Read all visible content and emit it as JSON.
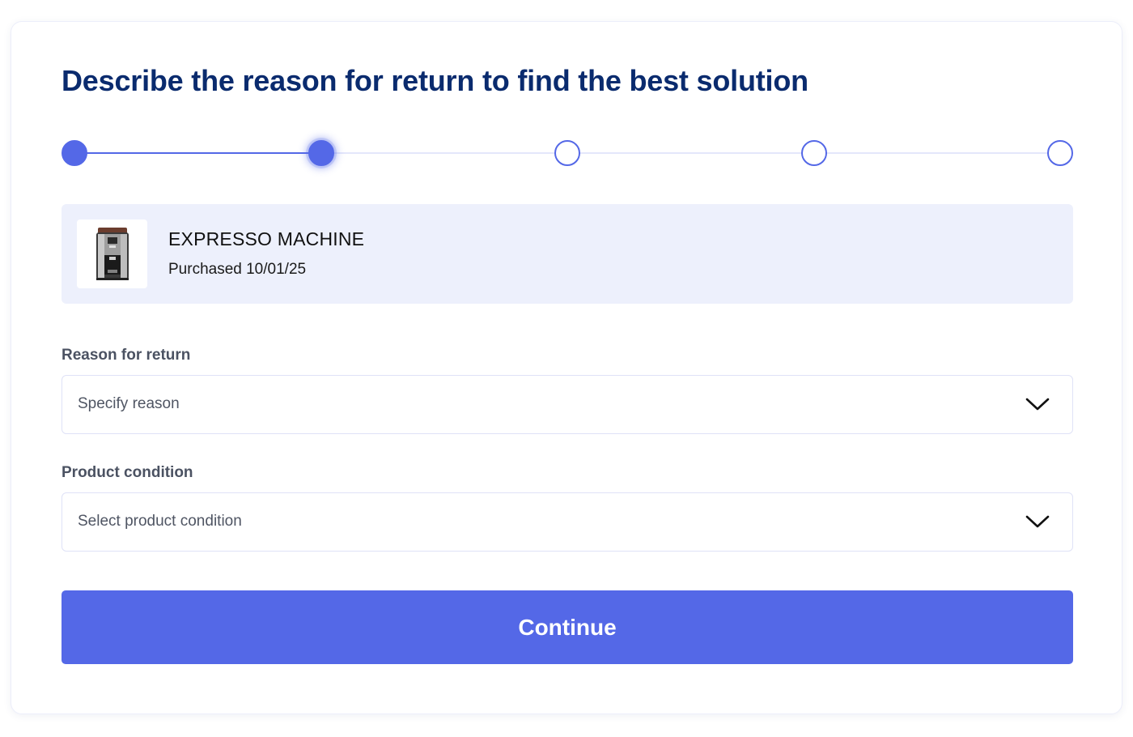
{
  "page": {
    "title": "Describe the reason for return to find the best solution"
  },
  "stepper": {
    "total_steps": 5,
    "completed_steps": 1,
    "current_step": 2,
    "accent_color": "#5468e7"
  },
  "product": {
    "image_icon": "espresso-machine-icon",
    "name": "EXPRESSO MACHINE",
    "purchased": "Purchased 10/01/25"
  },
  "form": {
    "reason": {
      "label": "Reason for return",
      "placeholder": "Specify reason",
      "icon": "chevron-down-icon"
    },
    "condition": {
      "label": "Product condition",
      "placeholder": "Select product condition",
      "icon": "chevron-down-icon"
    }
  },
  "actions": {
    "continue_label": "Continue",
    "button_color": "#5468e7"
  }
}
